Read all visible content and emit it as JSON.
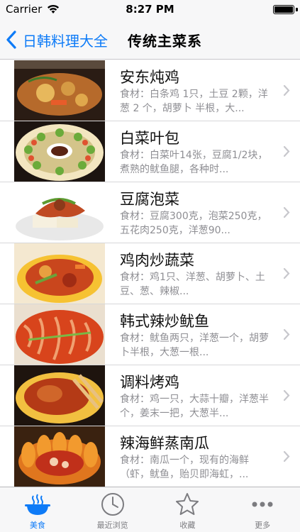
{
  "status_bar": {
    "carrier": "Carrier",
    "time": "8:27 PM"
  },
  "nav": {
    "back_label": "日韩料理大全",
    "title": "传统主菜系",
    "accent_color": "#0e7bf7"
  },
  "dishes": [
    {
      "title": "安东炖鸡",
      "desc": "食材：白条鸡 1只，土豆 2颗，洋葱 2 个，胡萝卜 半根，大..."
    },
    {
      "title": "白菜叶包",
      "desc": "食材：白菜叶14张，豆腐1/2块，煮熟的鱿鱼腿，各种时..."
    },
    {
      "title": "豆腐泡菜",
      "desc": "食材：豆腐300克，泡菜250克，五花肉250克，洋葱90..."
    },
    {
      "title": "鸡肉炒蔬菜",
      "desc": "食材：鸡1只、洋葱、胡萝卜、土豆、葱、辣椒..."
    },
    {
      "title": "韩式辣炒鱿鱼",
      "desc": "食材：鱿鱼两只，洋葱一个，胡萝卜半根，大葱一根..."
    },
    {
      "title": "调料烤鸡",
      "desc": "食材：鸡一只，大蒜十瓣，洋葱半个，姜末一把，大葱半..."
    },
    {
      "title": "辣海鲜蒸南瓜",
      "desc": "食材：南瓜一个，现有的海鲜（虾，鱿鱼，贻贝即海虹，..."
    }
  ],
  "tabs": [
    {
      "label": "美食",
      "icon": "food-bowl-icon",
      "active": true
    },
    {
      "label": "最近浏览",
      "icon": "clock-icon",
      "active": false
    },
    {
      "label": "收藏",
      "icon": "star-icon",
      "active": false
    },
    {
      "label": "更多",
      "icon": "more-dots-icon",
      "active": false
    }
  ]
}
